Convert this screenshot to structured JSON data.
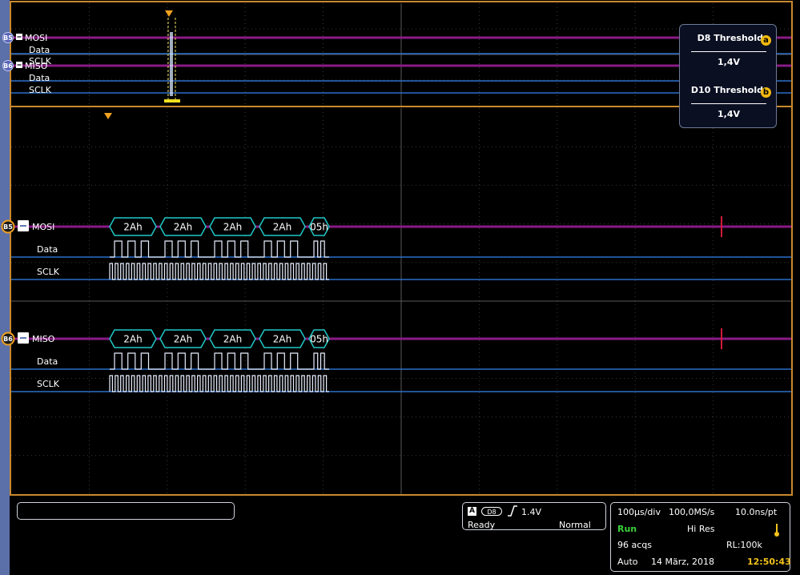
{
  "overview": {
    "buses": [
      {
        "badge": "B5",
        "name": "MOSI",
        "sub": [
          "Data",
          "SCLK"
        ]
      },
      {
        "badge": "B6",
        "name": "MISO",
        "sub": [
          "Data",
          "SCLK"
        ]
      }
    ]
  },
  "thresholds": [
    {
      "title": "D8 Threshold",
      "badge": "a",
      "value": "1,4V"
    },
    {
      "title": "D10 Threshold",
      "badge": "b",
      "value": "1,4V"
    }
  ],
  "decode": {
    "buses": [
      {
        "badge": "B5",
        "name": "MOSI",
        "data_label": "Data",
        "clock_label": "SCLK",
        "packets": [
          "2Ah",
          "2Ah",
          "2Ah",
          "2Ah",
          "05h"
        ]
      },
      {
        "badge": "B6",
        "name": "MISO",
        "data_label": "Data",
        "clock_label": "SCLK",
        "packets": [
          "2Ah",
          "2Ah",
          "2Ah",
          "2Ah",
          "05h"
        ]
      }
    ]
  },
  "trigger": {
    "channel": "A",
    "source": "D8",
    "level": "1.4V",
    "status": "Ready",
    "mode": "Normal"
  },
  "acquisition": {
    "timebase": "100µs/div",
    "sample_rate": "100,0MS/s",
    "resolution": "10.0ns/pt",
    "state": "Run",
    "acq_mode": "Hi Res",
    "acqs": "96 acqs",
    "record_length": "RL:100k",
    "trigger_mode": "Auto",
    "date": "14 März, 2018",
    "time": "12:50:43"
  },
  "colors": {
    "frame": "#c9892e",
    "bus": "#8a1a86",
    "signal": "#2a6fc9",
    "packet": "#20c8c8",
    "trigger_marker": "#f0a020",
    "badge": "#f2b80d",
    "run": "#39d23c"
  },
  "icons": {
    "trigger_edge": "rising-edge-icon",
    "temperature": "thermometer-icon"
  }
}
